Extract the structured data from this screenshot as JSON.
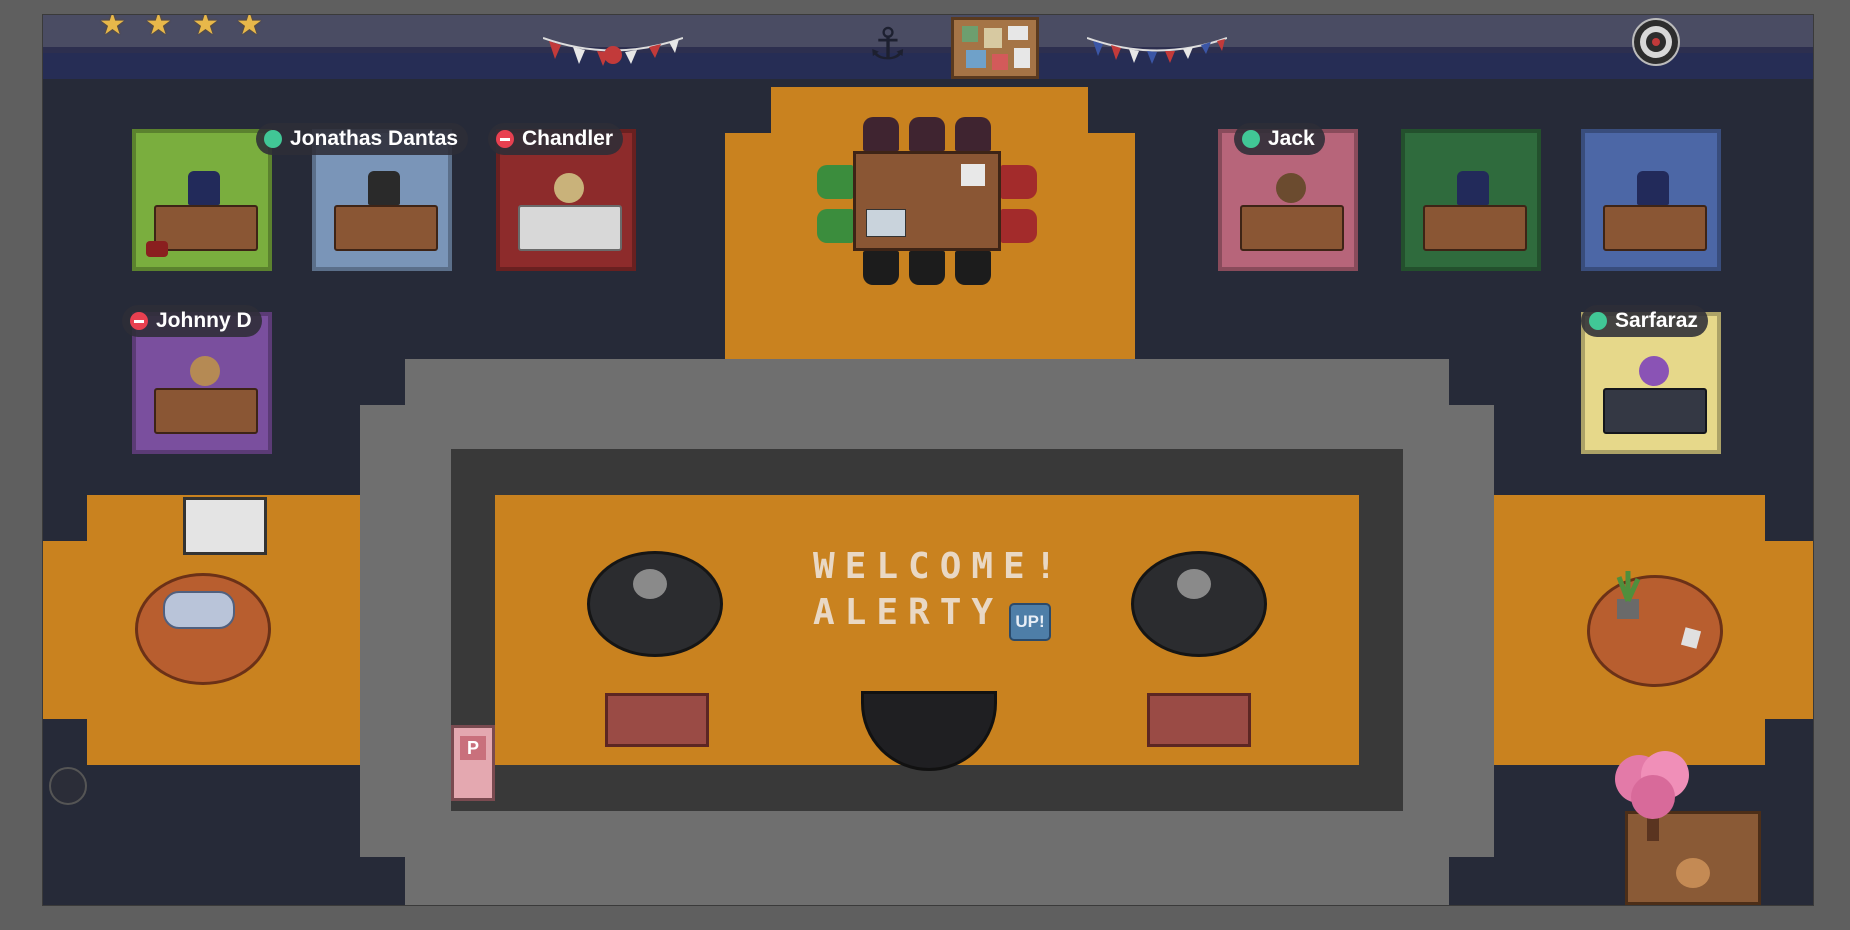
{
  "scene": {
    "welcome_line1": "WELCOME!",
    "welcome_line2": "ALERTY",
    "welcome_badge": "UP!",
    "sign_letter": "P",
    "stars_count": 4
  },
  "players": [
    {
      "name": "Jonathas Dantas",
      "status": "available"
    },
    {
      "name": "Chandler",
      "status": "busy"
    },
    {
      "name": "Jack",
      "status": "available"
    },
    {
      "name": "Johnny D",
      "status": "busy"
    },
    {
      "name": "Sarfaraz",
      "status": "available"
    }
  ],
  "colors": {
    "available": "#41c796",
    "busy": "#e84050",
    "floor": "#262a38",
    "carpet": "#c9821f"
  },
  "icons": [
    "star-icon",
    "anchor-icon",
    "dartboard-icon",
    "bunting-icon",
    "corkboard-icon",
    "plant-icon",
    "cherry-tree-icon"
  ]
}
